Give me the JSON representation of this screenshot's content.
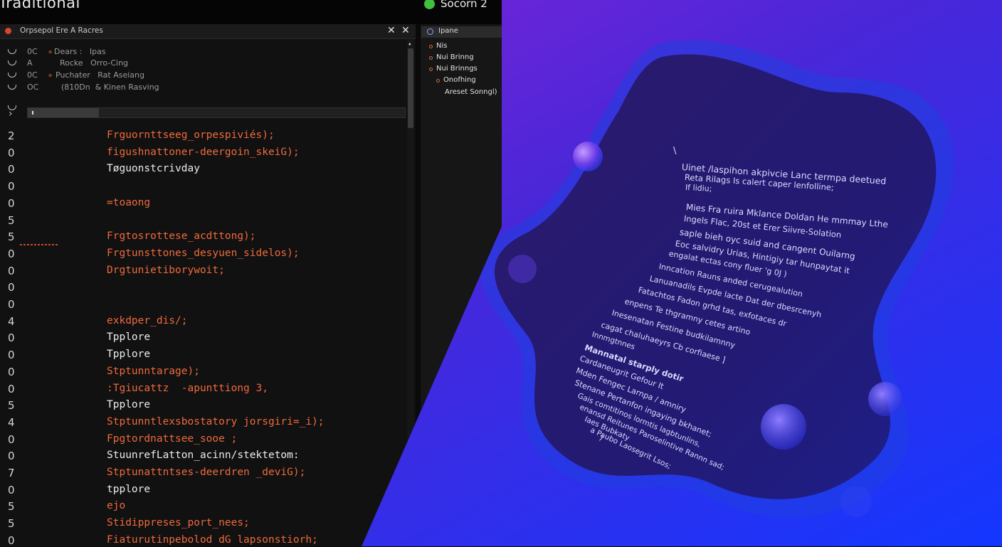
{
  "window": {
    "title": "Traditional",
    "brand_label": "Socorn 2"
  },
  "editor_tab": {
    "label": "Orpsepol Ere A Racres",
    "close_labels": [
      "✕",
      "✕"
    ]
  },
  "outline": [
    {
      "num": "0C",
      "text": "Dears :   Ipas"
    },
    {
      "num": "A",
      "text": "Rocke   Orro-Cing"
    },
    {
      "num": "0C",
      "text": "Puchater   Rat Aseiang"
    },
    {
      "num": "OC",
      "text": "(810Dn  & Kinen Rasving"
    }
  ],
  "code_lines": [
    {
      "ln": "2",
      "text": "Frguornttseeg_orpespiviés);",
      "color": "mix1"
    },
    {
      "ln": "0",
      "text": "figushnattoner-deergoin_skeiG);",
      "color": "ora"
    },
    {
      "ln": "0",
      "text": "Tøguonstcrivday",
      "color": "wht"
    },
    {
      "ln": "0",
      "text": "",
      "color": "wht"
    },
    {
      "ln": "0",
      "text": "=toaong",
      "color": "mix2"
    },
    {
      "ln": "5",
      "text": "",
      "color": "wht"
    },
    {
      "ln": "5",
      "text": "Frgtosrottese_acdttong);",
      "color": "mix1"
    },
    {
      "ln": "0",
      "text": "Frgtunsttones_desyuen_sidelos);",
      "color": "ora"
    },
    {
      "ln": "0",
      "text": "Drgtunietiborywoit;",
      "color": "mix1"
    },
    {
      "ln": "0",
      "text": "",
      "color": "wht"
    },
    {
      "ln": "0",
      "text": "",
      "color": "wht"
    },
    {
      "ln": "4",
      "text": "exkdper_dis/;",
      "color": "mix3"
    },
    {
      "ln": "0",
      "text": "Tpplore",
      "color": "wht"
    },
    {
      "ln": "0",
      "text": "Tpplore",
      "color": "wht"
    },
    {
      "ln": "0",
      "text": "Stptunntarage);",
      "color": "mix1"
    },
    {
      "ln": "0",
      "text": ":Tgiucattz  -apunttiong 3,",
      "color": "mix4"
    },
    {
      "ln": "5",
      "text": "Tpplore",
      "color": "wht"
    },
    {
      "ln": "4",
      "text": "Stptunntlexsbostatory jorsgiri=_i);",
      "color": "mix5"
    },
    {
      "ln": "0",
      "text": "Fpgtordnattsee_sooe ;",
      "color": "ora"
    },
    {
      "ln": "0",
      "text": "StuunrefLatton_acinn/stektetom:",
      "color": "wht"
    },
    {
      "ln": "7",
      "text": "Stptunattntses-deerdren _deviG);",
      "color": "ora"
    },
    {
      "ln": "0",
      "text": "tpplore",
      "color": "wht"
    },
    {
      "ln": "5",
      "text": "ejo",
      "color": "ora"
    },
    {
      "ln": "5",
      "text": "Stidippreses_port_nees;",
      "color": "mix1"
    },
    {
      "ln": "0",
      "text": "Fiaturutinpebolod dG lapsonstiorh;",
      "color": "mix6"
    }
  ],
  "side_panel": {
    "title": "Ipane",
    "items": [
      {
        "label": "Nis",
        "level": 0
      },
      {
        "label": "Nui Brinng",
        "level": 0
      },
      {
        "label": "Nui Brinngs",
        "level": 0
      },
      {
        "label": "Onofhing",
        "level": 1
      },
      {
        "label": "Areset Sonngl)",
        "level": 2
      }
    ]
  },
  "blob_text": [
    "\\",
    "Uinet /laspihon akpivcie Lanc termpa deetued",
    "Reta Rilags Is calert caper lenfolline;",
    "If lidiu;",
    "Mies Fra ruira Mklance Doldan He mmmay Lthe",
    "Ingels Flac, 20st et Erer Siivre-Solation",
    "saple bieh oyc suid and cangent Ouilarng",
    "Eoc salvidry Urias, Hintigiy tar hunpaytat it",
    "engalat ectas cony fluer 'g 0J )",
    "Inncation Rauns anded cerugealution",
    "Lanuanadils Evpde lacte Dat der dbesrcenyh",
    "Fatachtos Fadon grhd tas, exfotaces dr",
    "enpens Te thgramny cetes artino",
    "Inesenatan Festine budkilamnny",
    "cagat chaluhaeyrs Cb corfiaese ]",
    "Innmgtnnes",
    "Mannatal starply dotir",
    "Cardaneugrit Gefour It",
    "Mden Fengec Larnpa / amniry",
    "Stenane Pertanfon ingaying bkhanet;",
    "Gais comtitinos lormtis lagbtunlins,",
    "enansd Reitunes Paroselintive Rannn sad;",
    "Iaes Bubkaty",
    "a Paubo Laosegrit Lsos;",
    ")"
  ],
  "colors": {
    "accent_orange": "#ee6a3a",
    "tab_dot_red": "#d9472b",
    "brand_green": "#3fbf3f",
    "editor_bg": "#111112",
    "gradient_purple": "#8a1fd6",
    "gradient_blue": "#1a3cff"
  }
}
